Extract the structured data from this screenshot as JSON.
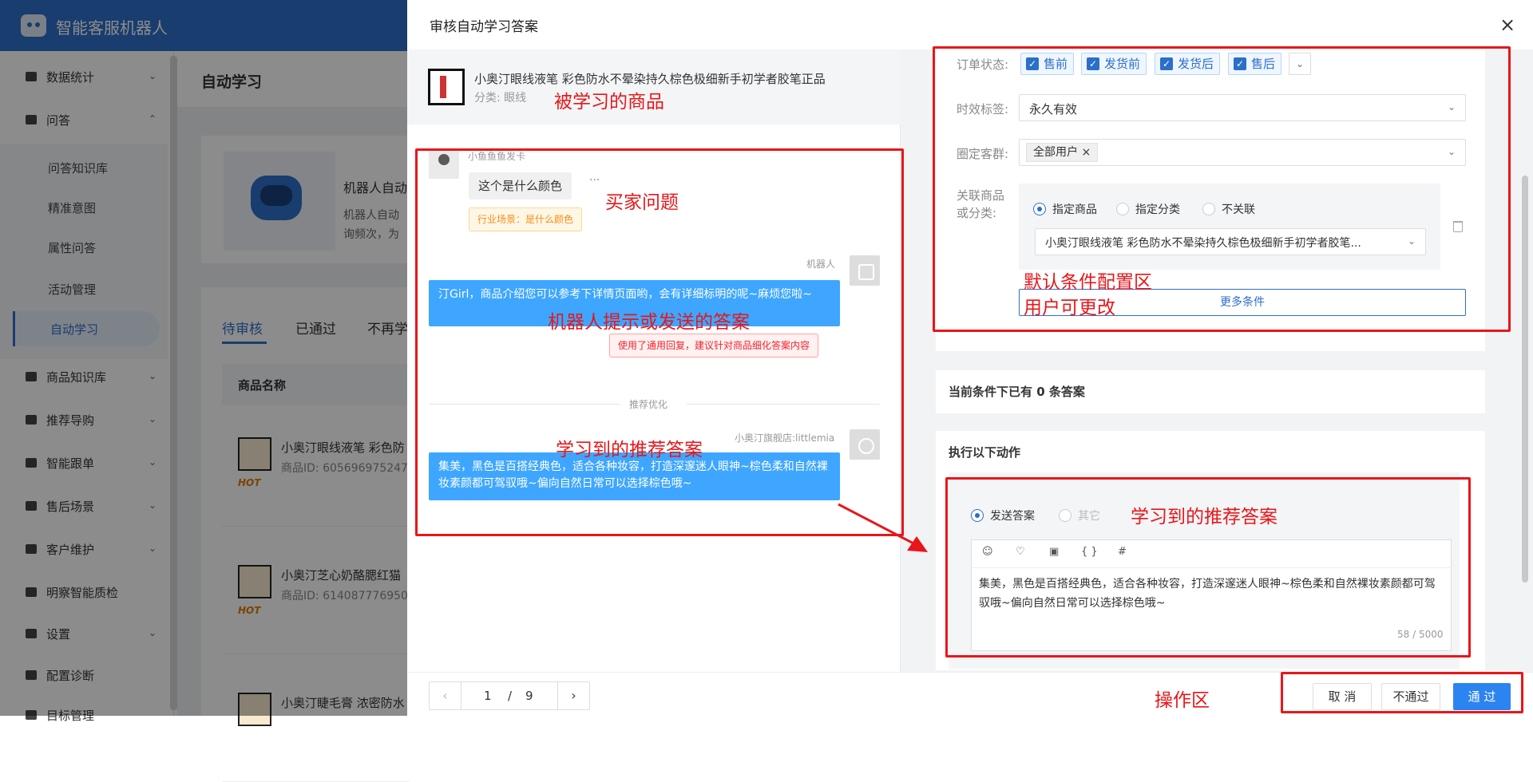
{
  "app": {
    "title": "智能客服机器人"
  },
  "sidenav": {
    "items": [
      {
        "label": "数据统计"
      },
      {
        "label": "问答"
      },
      {
        "label": "商品知识库"
      },
      {
        "label": "推荐导购"
      },
      {
        "label": "智能跟单"
      },
      {
        "label": "售后场景"
      },
      {
        "label": "客户维护"
      },
      {
        "label": "明察智能质检"
      },
      {
        "label": "设置"
      },
      {
        "label": "配置诊断"
      },
      {
        "label": "目标管理"
      }
    ],
    "sub_items": [
      {
        "label": "问答知识库"
      },
      {
        "label": "精准意图"
      },
      {
        "label": "属性问答"
      },
      {
        "label": "活动管理"
      },
      {
        "label": "自动学习"
      }
    ]
  },
  "main": {
    "page_title": "自动学习",
    "robot_card": {
      "title": "机器人自动",
      "text_line1": "机器人自动",
      "text_line2": "询频次，为"
    },
    "tabs": [
      {
        "label": "待审核"
      },
      {
        "label": "已通过"
      },
      {
        "label": "不再学"
      }
    ],
    "table_header": "商品名称",
    "rows": [
      {
        "name": "小奥汀眼线液笔 彩色防",
        "pid": "商品ID: 605696975247",
        "badge": "HOT"
      },
      {
        "name": "小奥汀芝心奶酪腮红猫",
        "pid": "商品ID: 614087776950",
        "badge": "HOT"
      },
      {
        "name": "小奥汀睫毛膏 浓密防水",
        "pid": ""
      }
    ]
  },
  "drawer": {
    "title": "审核自动学习答案",
    "product": {
      "name": "小奥汀眼线液笔 彩色防水不晕染持久棕色极细新手初学者胶笔正品",
      "category": "分类:  眼线"
    },
    "chat": {
      "buyer_name": "小鱼鱼鱼发卡",
      "buyer_message": "这个是什么颜色",
      "more": "···",
      "scene_tag": "行业场景：是什么颜色",
      "bot_name": "机器人",
      "bot_message": "汀Girl，商品介绍您可以参考下详情页面哟，会有详细标明的呢~麻烦您啦~",
      "warn_tag": "使用了通用回复，建议针对商品细化答案内容",
      "divider": "推荐优化",
      "shop_name": "小奥汀旗舰店:littlemia",
      "recommended_answer": "集美，黑色是百搭经典色，适合各种妆容，打造深邃迷人眼神~棕色柔和自然裸妆素颜都可驾驭哦~偏向自然日常可以选择棕色哦~"
    },
    "conditions": {
      "order_status_label": "订单状态:",
      "order_status_options": [
        {
          "label": "售前"
        },
        {
          "label": "发货前"
        },
        {
          "label": "发货后"
        },
        {
          "label": "售后"
        }
      ],
      "time_label": "时效标签:",
      "time_value": "永久有效",
      "crowd_label": "圈定客群:",
      "crowd_tag": "全部用户",
      "assoc_label_1": "关联商品",
      "assoc_label_2": "或分类:",
      "assoc_options": [
        {
          "label": "指定商品"
        },
        {
          "label": "指定分类"
        },
        {
          "label": "不关联"
        }
      ],
      "assoc_selected": "指定商品",
      "assoc_product": "小奥汀眼线液笔 彩色防水不晕染持久棕色极细新手初学者胶笔...",
      "more_conditions": "更多条件"
    },
    "count_text": "当前条件下已有 0 条答案",
    "action": {
      "title": "执行以下动作",
      "options": [
        {
          "label": "发送答案"
        },
        {
          "label": "其它"
        }
      ],
      "editor_text": "集美，黑色是百搭经典色，适合各种妆容，打造深邃迷人眼神~棕色柔和自然裸妆素颜都可驾驭哦~偏向自然日常可以选择棕色哦~",
      "char_count": "58 / 5000"
    },
    "pager": {
      "current": "1",
      "sep": "/",
      "total": "9"
    },
    "buttons": {
      "cancel": "取 消",
      "reject": "不通过",
      "approve": "通 过"
    }
  },
  "annotations": {
    "product": "被学习的商品",
    "buyer_question": "买家问题",
    "bot_answer": "机器人提示或发送的答案",
    "learned_answer_left": "学习到的推荐答案",
    "default_conditions_1": "默认条件配置区",
    "default_conditions_2": "用户可更改",
    "learned_answer_right": "学习到的推荐答案",
    "operation_area": "操作区"
  },
  "colors": {
    "accent": "#2c84f0",
    "annotation_red": "#e8161a",
    "bubble_blue": "#3ea6ff"
  }
}
